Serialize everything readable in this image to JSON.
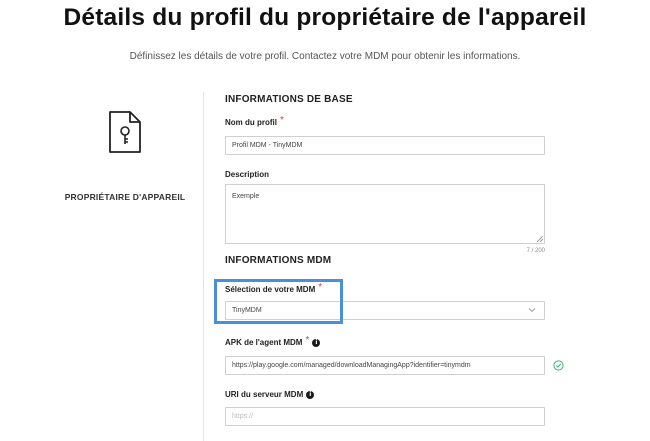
{
  "page": {
    "title": "Détails du profil du propriétaire de l'appareil",
    "subtitle": "Définissez les détails de votre profil. Contactez votre MDM pour obtenir les informations."
  },
  "left_panel": {
    "icon": "document-key-icon",
    "label": "PROPRIÉTAIRE D'APPAREIL"
  },
  "basic_info": {
    "section_title": "INFORMATIONS DE BASE",
    "profile_name_label": "Nom du profil",
    "profile_name_value": "Profil MDM - TinyMDM",
    "description_label": "Description",
    "description_value": "Exemple",
    "description_counter": "7 / 200"
  },
  "mdm_info": {
    "section_title": "INFORMATIONS MDM",
    "mdm_select_label": "Sélection de votre MDM",
    "mdm_select_value": "TinyMDM",
    "apk_label": "APK de l'agent MDM",
    "apk_value": "https://play.google.com/managed/downloadManagingApp?identifier=tinymdm",
    "server_uri_label": "URI du serveur MDM",
    "server_uri_placeholder": "https://"
  },
  "colors": {
    "required": "#e03a3a",
    "highlight": "#4a90d9",
    "valid": "#3cb371"
  }
}
